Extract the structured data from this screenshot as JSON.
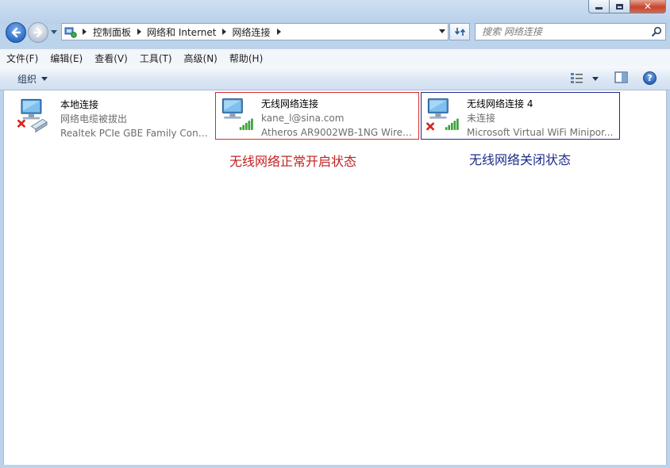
{
  "address_bar": {
    "crumbs": [
      "控制面板",
      "网络和 Internet",
      "网络连接"
    ]
  },
  "search": {
    "placeholder": "搜索 网络连接"
  },
  "menu": {
    "items": [
      "文件(F)",
      "编辑(E)",
      "查看(V)",
      "工具(T)",
      "高级(N)",
      "帮助(H)"
    ]
  },
  "toolbar": {
    "organize_label": "组织",
    "help_label": "?"
  },
  "connections": [
    {
      "name": "本地连接",
      "status": "网络电缆被拔出",
      "adapter": "Realtek PCIe GBE Family Contr...",
      "icon": "wired-network-disconnected-icon"
    },
    {
      "name": "无线网络连接",
      "status": "kane_l@sina.com",
      "adapter": "Atheros AR9002WB-1NG Wirel...",
      "icon": "wireless-network-icon"
    },
    {
      "name": "无线网络连接 4",
      "status": "未连接",
      "adapter": "Microsoft Virtual WiFi Minipor...",
      "icon": "wireless-network-disconnected-icon"
    }
  ],
  "annotations": {
    "wifi_on": "无线网络正常开启状态",
    "wifi_off": "无线网络关闭状态"
  },
  "colors": {
    "annotation_on": "#c32121",
    "annotation_off": "#1f2b8c",
    "highlight_on_border": "#d92a2a",
    "highlight_off_border": "#1f2d8f"
  }
}
